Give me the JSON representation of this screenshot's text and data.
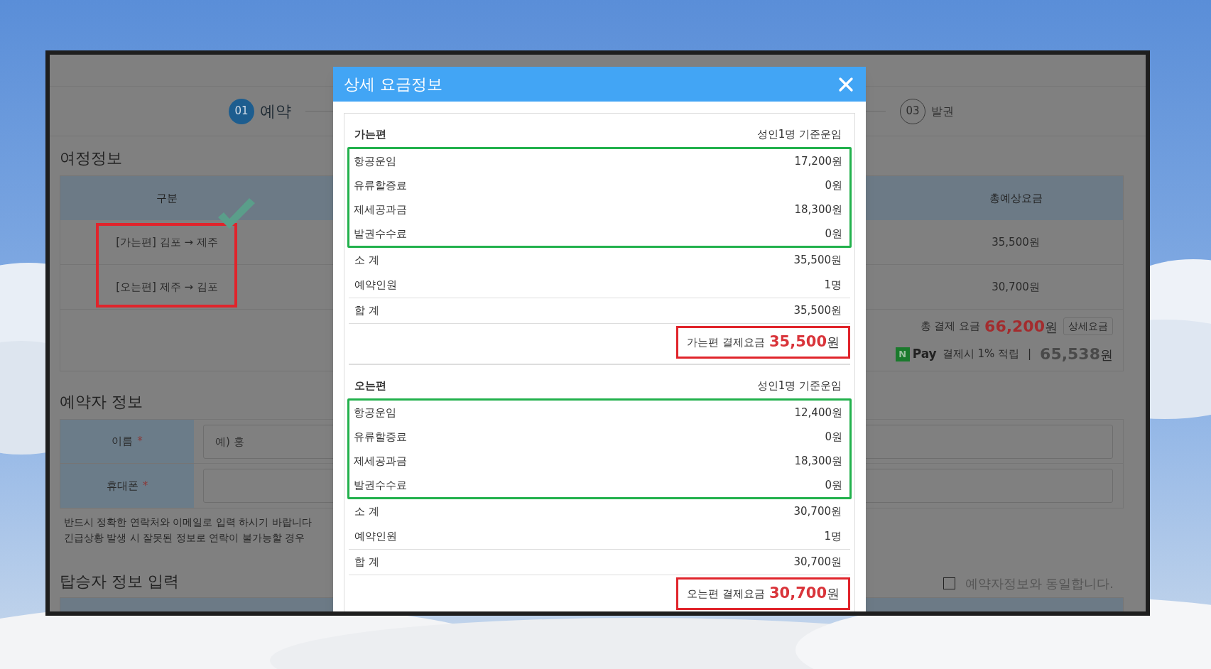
{
  "page": {
    "steps": [
      {
        "number": "01",
        "label": "예약",
        "selected": true
      },
      {
        "number": "03",
        "label": "발권",
        "selected": false
      }
    ],
    "itinerary": {
      "title": "여정정보",
      "columns": [
        "구분",
        "총예상요금"
      ],
      "routes_highlighted": true,
      "rows": [
        {
          "route": "[가는편] 김포 → 제주",
          "total": "35,500원"
        },
        {
          "route": "[오는편] 제주 → 김포",
          "total": "30,700원"
        }
      ],
      "summary": {
        "total_label": "총 결제 요금",
        "total_amount": "66,200",
        "total_unit": "원",
        "detail_button": "상세요금",
        "npay_badge": "N",
        "npay_label": "Pay",
        "npay_text": "결제시 1% 적립",
        "separator": "|",
        "npay_amount": "65,538",
        "npay_unit": "원"
      }
    },
    "booker": {
      "title": "예약자 정보",
      "fields": [
        {
          "label": "이름",
          "required_mark": "*",
          "placeholder": "예) 홍"
        },
        {
          "label": "휴대폰",
          "required_mark": "*"
        }
      ],
      "notes": [
        "반드시 정확한 연락처와 이메일로 입력 하시기 바랍니다",
        "긴급상황 발생 시 잘못된 정보로 연락이 불가능할 경우"
      ]
    },
    "passenger": {
      "title": "탑승자 정보 입력",
      "same_as_booker": {
        "label": "예약자정보와 동일합니다.",
        "checked": false
      }
    }
  },
  "modal": {
    "title": "상세 요금정보",
    "sections": [
      {
        "title": "가는편",
        "basis": "성인1명 기준운임",
        "breakdown": {
          "highlighted": true,
          "items": [
            {
              "label": "항공운임",
              "value": "17,200원"
            },
            {
              "label": "유류할증료",
              "value": "0원"
            },
            {
              "label": "제세공과금",
              "value": "18,300원"
            },
            {
              "label": "발권수수료",
              "value": "0원"
            }
          ]
        },
        "subtotal": {
          "label": "소 계",
          "value": "35,500원"
        },
        "passengers": {
          "label": "예약인원",
          "value": "1명"
        },
        "total": {
          "label": "합 계",
          "value": "35,500원"
        },
        "payment": {
          "label": "가는편 결제요금",
          "amount": "35,500",
          "unit": "원",
          "highlighted": true
        }
      },
      {
        "title": "오는편",
        "basis": "성인1명 기준운임",
        "breakdown": {
          "highlighted": true,
          "items": [
            {
              "label": "항공운임",
              "value": "12,400원"
            },
            {
              "label": "유류할증료",
              "value": "0원"
            },
            {
              "label": "제세공과금",
              "value": "18,300원"
            },
            {
              "label": "발권수수료",
              "value": "0원"
            }
          ]
        },
        "subtotal": {
          "label": "소 계",
          "value": "30,700원"
        },
        "passengers": {
          "label": "예약인원",
          "value": "1명"
        },
        "total": {
          "label": "합 계",
          "value": "30,700원"
        },
        "payment": {
          "label": "오는편 결제요금",
          "amount": "30,700",
          "unit": "원",
          "highlighted": true
        }
      }
    ]
  }
}
